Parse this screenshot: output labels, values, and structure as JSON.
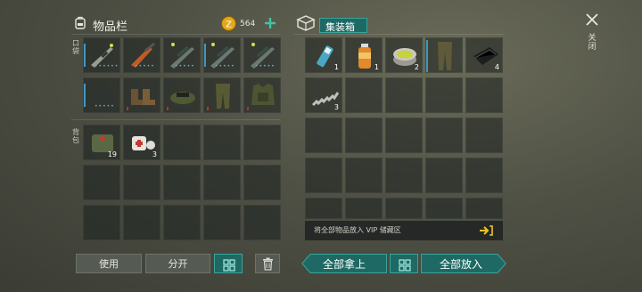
{
  "inventory": {
    "title": "物品栏",
    "coins": "564",
    "pocket_label": "口袋",
    "backpack_label": "背包",
    "pocket_items": [
      {
        "icon": "rifle-icon",
        "count": ""
      },
      {
        "icon": "shotgun-icon",
        "count": ""
      },
      {
        "icon": "scoped-rifle-icon",
        "count": ""
      },
      {
        "icon": "scoped-rifle-icon",
        "count": ""
      },
      {
        "icon": "scoped-rifle-icon",
        "count": ""
      },
      {
        "icon": "pistol-icon",
        "count": ""
      },
      {
        "icon": "boots-icon",
        "count": ""
      },
      {
        "icon": "cap-icon",
        "count": ""
      },
      {
        "icon": "pants-icon",
        "count": ""
      },
      {
        "icon": "armor-vest-icon",
        "count": ""
      }
    ],
    "backpack_items": [
      {
        "icon": "medkit-bag-icon",
        "count": "19"
      },
      {
        "icon": "first-aid-icon",
        "count": "3"
      }
    ]
  },
  "container": {
    "title": "集装箱",
    "close_label": "关闭",
    "items": [
      {
        "icon": "spray-can-icon",
        "count": "1"
      },
      {
        "icon": "bottle-icon",
        "count": "1"
      },
      {
        "icon": "tin-can-icon",
        "count": "2"
      },
      {
        "icon": "trousers-icon",
        "count": ""
      },
      {
        "icon": "wallet-icon",
        "count": "4"
      },
      {
        "icon": "spring-icon",
        "count": "3"
      }
    ],
    "vip_text": "将全部物品放入 VIP 储藏区"
  },
  "buttons": {
    "use": "使用",
    "split": "分开",
    "take_all": "全部拿上",
    "put_all": "全部放入"
  },
  "colors": {
    "accent": "#1f6964",
    "accent_border": "#3ba39a",
    "rarity_red": "#b8322c",
    "rarity_blue": "#3a98c3",
    "coin": "#e0a91c"
  }
}
